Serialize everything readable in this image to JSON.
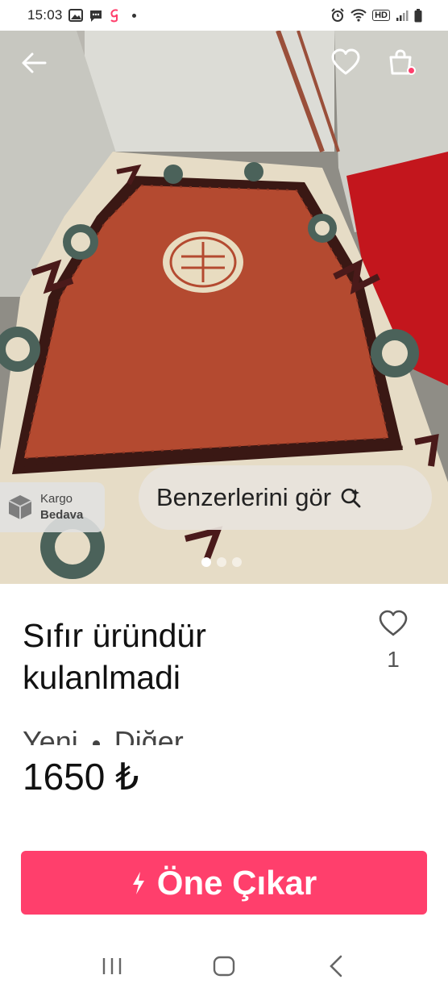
{
  "status_bar": {
    "time": "15:03",
    "icons_left": [
      "image-icon",
      "message-icon",
      "app-g-icon",
      "dot-icon"
    ],
    "icons_right": [
      "alarm-icon",
      "wifi-icon",
      "hd-voice-icon",
      "signal-icon",
      "battery-icon"
    ],
    "hd_label": "HD"
  },
  "hero": {
    "cargo": {
      "line1": "Kargo",
      "line2": "Bedava"
    },
    "similar_label": "Benzerlerini gör",
    "image_count": 3,
    "active_image": 1
  },
  "product": {
    "title": "Sıfır üründür kulanlmadi",
    "likes": "1",
    "condition": "Yeni",
    "category": "Diğer",
    "price": "1650 ₺"
  },
  "actions": {
    "boost_label": "Öne Çıkar"
  },
  "colors": {
    "accent": "#ff3f6c",
    "text": "#111111",
    "secondary": "#555555"
  }
}
